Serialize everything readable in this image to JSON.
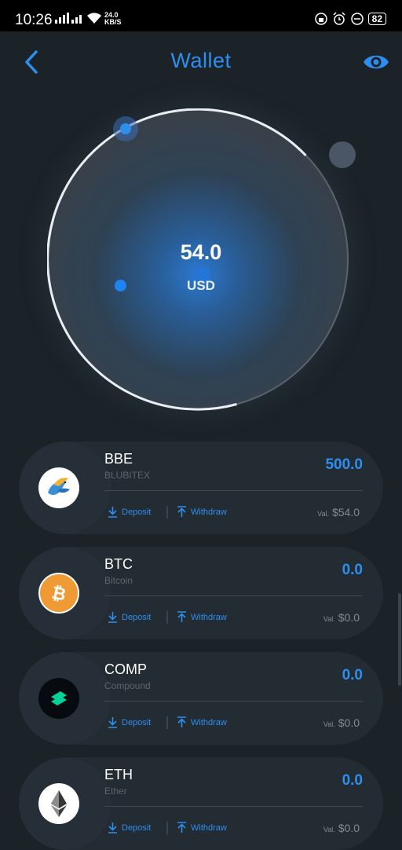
{
  "status_bar": {
    "time": "10:26",
    "net_speed_value": "24.0",
    "net_speed_unit": "KB/S",
    "battery": "82"
  },
  "header": {
    "title": "Wallet"
  },
  "summary": {
    "value": "54.0",
    "unit": "USD"
  },
  "actions": {
    "deposit_label": "Deposit",
    "withdraw_label": "Withdraw",
    "val_prefix": "Val."
  },
  "tokens": [
    {
      "symbol": "BBE",
      "name": "BLUBITEX",
      "balance": "500.0",
      "value": "$54.0",
      "icon": "blubitex-bird-icon"
    },
    {
      "symbol": "BTC",
      "name": "Bitcoin",
      "balance": "0.0",
      "value": "$0.0",
      "icon": "bitcoin-icon"
    },
    {
      "symbol": "COMP",
      "name": "Compound",
      "balance": "0.0",
      "value": "$0.0",
      "icon": "compound-icon"
    },
    {
      "symbol": "ETH",
      "name": "Ether",
      "balance": "0.0",
      "value": "$0.0",
      "icon": "ethereum-icon"
    }
  ],
  "colors": {
    "accent": "#2e8ef0",
    "background": "#1b2329",
    "card": "#232c33",
    "bitcoin": "#f09a36",
    "compound": "#00d395"
  }
}
